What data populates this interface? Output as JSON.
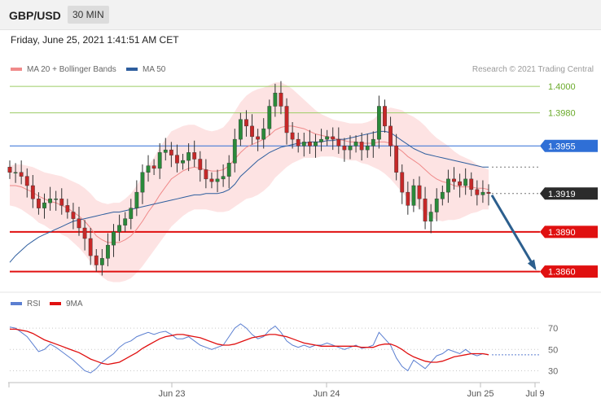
{
  "header": {
    "symbol": "GBP/USD",
    "timeframe": "30 MIN"
  },
  "date_line": "Friday, June 25, 2021 1:41:51 AM CET",
  "credit": "Research © 2021 Trading Central",
  "legend": {
    "bollinger": {
      "label": "MA 20 + Bollinger Bands",
      "color": "#f08a8a"
    },
    "ma50": {
      "label": "MA 50",
      "color": "#2e5e9e"
    },
    "rsi": {
      "label": "RSI",
      "color": "#5b7fd1"
    },
    "rsi_ma": {
      "label": "9MA",
      "color": "#e01010"
    }
  },
  "colors": {
    "up": "#2a8a3a",
    "down": "#c62828",
    "band": "#fde0e0",
    "arrow": "#2c5f8e",
    "support": "#e01010",
    "resist": "#9ccc65",
    "pivot": "#2f6fd6"
  },
  "chart_data": [
    {
      "type": "candlestick",
      "title": "GBP/USD",
      "ylim": [
        1.3845,
        1.4005
      ],
      "x_ticks": [
        "Jun 23",
        "Jun 24",
        "Jun 25",
        "Jul 9"
      ],
      "levels": [
        {
          "value": 1.4,
          "label": "1.4000",
          "kind": "resistance"
        },
        {
          "value": 1.398,
          "label": "1.3980",
          "kind": "resistance"
        },
        {
          "value": 1.3955,
          "label": "1.3955",
          "kind": "pivot"
        },
        {
          "value": 1.3919,
          "label": "1.3919",
          "kind": "last"
        },
        {
          "value": 1.389,
          "label": "1.3890",
          "kind": "support"
        },
        {
          "value": 1.386,
          "label": "1.3860",
          "kind": "support"
        }
      ],
      "closes": [
        1.3935,
        1.3935,
        1.3932,
        1.3925,
        1.3915,
        1.3908,
        1.3912,
        1.3915,
        1.3915,
        1.391,
        1.3905,
        1.39,
        1.3893,
        1.3885,
        1.3872,
        1.3865,
        1.387,
        1.388,
        1.389,
        1.3895,
        1.39,
        1.3908,
        1.392,
        1.3935,
        1.394,
        1.3938,
        1.395,
        1.3952,
        1.3948,
        1.3942,
        1.3944,
        1.395,
        1.3945,
        1.3937,
        1.393,
        1.3928,
        1.393,
        1.3932,
        1.3942,
        1.396,
        1.3975,
        1.397,
        1.3962,
        1.396,
        1.3968,
        1.3985,
        1.3995,
        1.3985,
        1.3965,
        1.396,
        1.3955,
        1.3958,
        1.3955,
        1.3958,
        1.396,
        1.3962,
        1.396,
        1.3955,
        1.3952,
        1.3955,
        1.3958,
        1.3952,
        1.3955,
        1.396,
        1.3985,
        1.397,
        1.3955,
        1.3935,
        1.392,
        1.391,
        1.3925,
        1.3915,
        1.3898,
        1.3905,
        1.3915,
        1.392,
        1.393,
        1.3928,
        1.3925,
        1.393,
        1.3922,
        1.3918,
        1.392,
        1.3919
      ],
      "ma20": [
        1.3925,
        1.3925,
        1.3924,
        1.3922,
        1.392,
        1.3917,
        1.3915,
        1.3913,
        1.3912,
        1.391,
        1.3908,
        1.3905,
        1.3902,
        1.3898,
        1.3893,
        1.3887,
        1.3884,
        1.3882,
        1.3882,
        1.3882,
        1.3884,
        1.3887,
        1.3892,
        1.3898,
        1.3905,
        1.3911,
        1.3918,
        1.3924,
        1.393,
        1.3933,
        1.3936,
        1.3938,
        1.3939,
        1.3938,
        1.3937,
        1.3936,
        1.3936,
        1.3937,
        1.394,
        1.3945,
        1.395,
        1.3954,
        1.3956,
        1.3958,
        1.396,
        1.3963,
        1.3967,
        1.3969,
        1.397,
        1.397,
        1.3969,
        1.3968,
        1.3966,
        1.3964,
        1.3963,
        1.3962,
        1.3961,
        1.396,
        1.3959,
        1.3958,
        1.3958,
        1.3957,
        1.3957,
        1.3957,
        1.3958,
        1.3958,
        1.3957,
        1.3954,
        1.3951,
        1.3947,
        1.3944,
        1.3941,
        1.3937,
        1.3933,
        1.393,
        1.3928,
        1.3927,
        1.3925,
        1.3924,
        1.3924,
        1.3924,
        1.3923,
        1.3923,
        1.3922
      ],
      "ma50": [
        1.3867,
        1.3872,
        1.3876,
        1.388,
        1.3883,
        1.3886,
        1.3888,
        1.389,
        1.3892,
        1.3894,
        1.3896,
        1.3898,
        1.3899,
        1.39,
        1.3901,
        1.3902,
        1.3903,
        1.3904,
        1.3905,
        1.3905,
        1.3906,
        1.3907,
        1.3908,
        1.3909,
        1.391,
        1.3911,
        1.3912,
        1.3913,
        1.3914,
        1.3915,
        1.3916,
        1.3917,
        1.3918,
        1.3918,
        1.3919,
        1.3919,
        1.3919,
        1.392,
        1.3922,
        1.3926,
        1.3932,
        1.3936,
        1.394,
        1.3944,
        1.3947,
        1.395,
        1.3952,
        1.3954,
        1.3955,
        1.3956,
        1.3957,
        1.3957,
        1.3958,
        1.3958,
        1.3958,
        1.3959,
        1.3959,
        1.396,
        1.396,
        1.3961,
        1.3962,
        1.3963,
        1.3964,
        1.3965,
        1.3966,
        1.3966,
        1.3965,
        1.3962,
        1.3959,
        1.3956,
        1.3953,
        1.3951,
        1.3949,
        1.3948,
        1.3947,
        1.3946,
        1.3945,
        1.3944,
        1.3943,
        1.3942,
        1.3941,
        1.394,
        1.3939,
        1.3939
      ],
      "band_width": [
        0.0015,
        0.0016,
        0.0017,
        0.0018,
        0.0019,
        0.002,
        0.002,
        0.0021,
        0.0021,
        0.0022,
        0.0022,
        0.0023,
        0.0024,
        0.0025,
        0.0026,
        0.0027,
        0.0028,
        0.0029,
        0.003,
        0.003,
        0.0031,
        0.0032,
        0.0033,
        0.0034,
        0.0035,
        0.0035,
        0.0036,
        0.0036,
        0.0036,
        0.0035,
        0.0034,
        0.0033,
        0.0032,
        0.0031,
        0.003,
        0.003,
        0.0031,
        0.0032,
        0.0034,
        0.0036,
        0.0038,
        0.0039,
        0.004,
        0.004,
        0.0039,
        0.0038,
        0.0036,
        0.0034,
        0.0031,
        0.0028,
        0.0025,
        0.0022,
        0.002,
        0.0018,
        0.0016,
        0.0015,
        0.0014,
        0.0014,
        0.0014,
        0.0014,
        0.0014,
        0.0015,
        0.0016,
        0.0018,
        0.0021,
        0.0024,
        0.0027,
        0.0029,
        0.0031,
        0.0032,
        0.0033,
        0.0033,
        0.0033,
        0.0032,
        0.0031,
        0.003,
        0.0028,
        0.0026,
        0.0024,
        0.0022,
        0.002,
        0.0018,
        0.0016,
        0.0015
      ],
      "forecast": {
        "from_value": 1.3919,
        "to_value": 1.386
      }
    },
    {
      "type": "line",
      "ylim": [
        25,
        80
      ],
      "y_ticks": [
        70,
        50,
        30
      ],
      "series": [
        {
          "name": "RSI",
          "values": [
            71,
            70,
            66,
            62,
            55,
            48,
            50,
            55,
            52,
            48,
            44,
            40,
            35,
            30,
            28,
            32,
            38,
            42,
            46,
            52,
            56,
            58,
            62,
            64,
            66,
            64,
            66,
            67,
            64,
            60,
            60,
            62,
            58,
            54,
            52,
            50,
            52,
            54,
            62,
            70,
            74,
            70,
            64,
            60,
            62,
            68,
            72,
            66,
            58,
            54,
            52,
            54,
            52,
            54,
            54,
            56,
            54,
            52,
            50,
            52,
            54,
            51,
            52,
            54,
            66,
            60,
            54,
            42,
            34,
            30,
            40,
            36,
            32,
            38,
            44,
            46,
            50,
            48,
            46,
            50,
            46,
            44,
            46,
            45
          ]
        },
        {
          "name": "9MA",
          "values": [
            69,
            69,
            68,
            67,
            65,
            62,
            59,
            57,
            55,
            53,
            51,
            49,
            47,
            44,
            41,
            39,
            37,
            36,
            37,
            38,
            41,
            44,
            47,
            51,
            54,
            57,
            60,
            62,
            63,
            64,
            64,
            63,
            62,
            61,
            59,
            57,
            55,
            54,
            54,
            55,
            57,
            59,
            61,
            62,
            63,
            64,
            64,
            63,
            62,
            60,
            58,
            56,
            55,
            54,
            53,
            53,
            53,
            53,
            53,
            53,
            53,
            52,
            52,
            52,
            54,
            55,
            55,
            53,
            50,
            46,
            43,
            41,
            39,
            38,
            38,
            39,
            41,
            43,
            44,
            45,
            46,
            46,
            46,
            45
          ]
        }
      ]
    }
  ]
}
